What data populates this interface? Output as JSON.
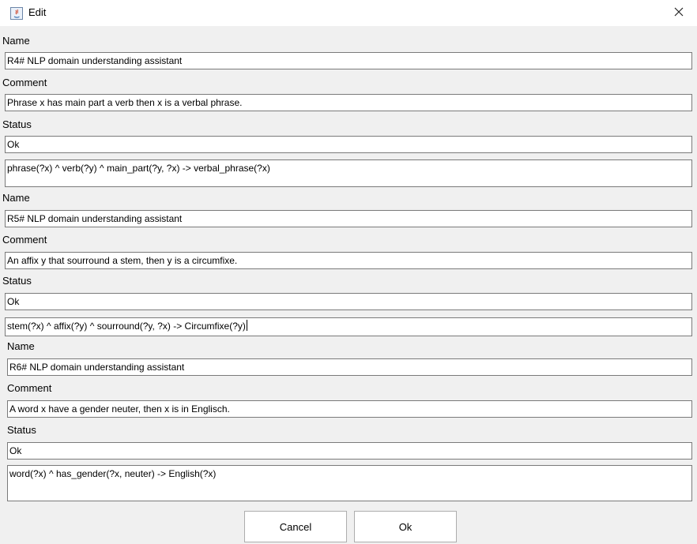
{
  "window": {
    "title": "Edit",
    "icon": "java-app-icon",
    "close_icon": "close-icon"
  },
  "rules": [
    {
      "name_label": "Name",
      "name_value": "R4# NLP domain understanding assistant",
      "comment_label": "Comment",
      "comment_value": "Phrase x  has main part a verb then x is a verbal phrase.",
      "status_label": "Status",
      "status_value": "Ok",
      "rule_text": "phrase(?x) ^ verb(?y) ^ main_part(?y, ?x) -> verbal_phrase(?x)"
    },
    {
      "name_label": "Name",
      "name_value": "R5# NLP domain understanding assistant",
      "comment_label": "Comment",
      "comment_value": "An affix y that sourround a stem, then y is a circumfixe.",
      "status_label": "Status",
      "status_value": "Ok",
      "rule_text": "stem(?x) ^ affix(?y) ^ sourround(?y, ?x) -> Circumfixe(?y)"
    },
    {
      "name_label": "Name",
      "name_value": "R6# NLP domain understanding assistant",
      "comment_label": "Comment",
      "comment_value": "A word x have a gender neuter, then x is in Englisch.",
      "status_label": "Status",
      "status_value": "Ok",
      "rule_text": "word(?x) ^ has_gender(?x, neuter) -> English(?x)"
    }
  ],
  "buttons": {
    "cancel_label": "Cancel",
    "ok_label": "Ok"
  }
}
